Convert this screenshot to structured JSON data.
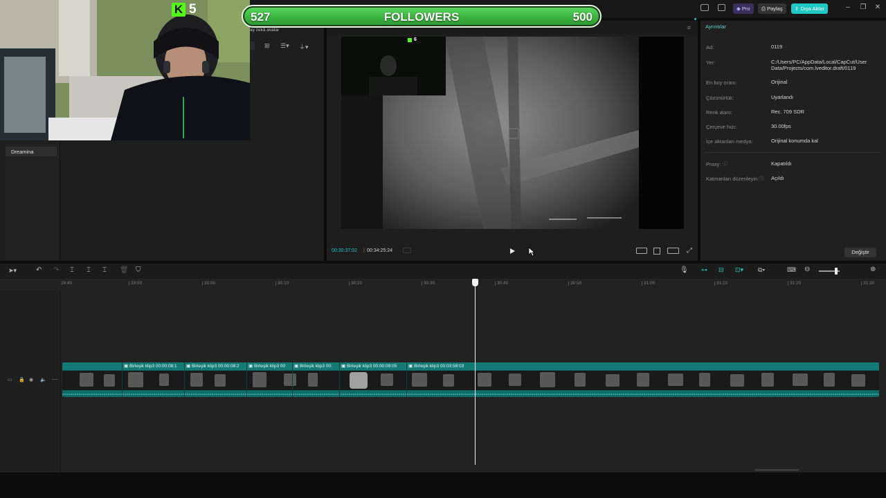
{
  "topbar": {
    "pro_label": "Pro",
    "share_label": "Paylaş",
    "export_label": "Dışa Aktar",
    "accent_color": "#1fc7c2"
  },
  "media": {
    "sidebar_item": "Dreamina",
    "partial_caption": "ay zekâ avatar"
  },
  "player": {
    "current_time": "00:30:37:02",
    "total_time": "00:34:25:24",
    "mini_webcam_count": "6"
  },
  "details": {
    "title": "Ayrıntılar",
    "rows": [
      {
        "label": "Ad:",
        "value": "0119"
      },
      {
        "label": "Yer:",
        "value": "C:/Users/PC/AppData/Local/CapCut/User Data/Projects/com.lveditor.draft/0119"
      },
      {
        "label": "En boy oranı:",
        "value": "Orijinal"
      },
      {
        "label": "Çözünürlük:",
        "value": "Uyarlandı"
      },
      {
        "label": "Renk alanı:",
        "value": "Rec. 709 SDR"
      },
      {
        "label": "Çerçeve hızı:",
        "value": "30.00fps"
      },
      {
        "label": "İçe aktarılan medya:",
        "value": "Orijinal konumda kal"
      },
      {
        "label": "Proxy:",
        "value": "Kapatıldı"
      },
      {
        "label": "Katmanları düzenleyin:",
        "value": "Açıldı"
      }
    ],
    "modify_button": "Değiştir"
  },
  "timeline": {
    "ruler": [
      "29:40",
      "29:50",
      "30:00",
      "30:10",
      "30:20",
      "30:30",
      "30:40",
      "30:50",
      "31:00",
      "31:10",
      "31:20",
      "31:30"
    ],
    "clips": [
      {
        "label": "Birleşik klip3",
        "time": "00:00:08:1"
      },
      {
        "label": "Birleşik klip3",
        "time": "00:00:08:2"
      },
      {
        "label": "Birleşik klip3",
        "time": "00"
      },
      {
        "label": "Birleşik klip3",
        "time": "00:"
      },
      {
        "label": "Birleşik klip3",
        "time": "00:00:09:05"
      },
      {
        "label": "Birleşik klip3",
        "time": "00:03:58:03"
      }
    ]
  },
  "overlay": {
    "kick_count": "5",
    "followers_current": "527",
    "followers_label": "FOLLOWERS",
    "followers_goal": "500",
    "followers_progress": 1.0,
    "kick_color": "#53fc18"
  }
}
